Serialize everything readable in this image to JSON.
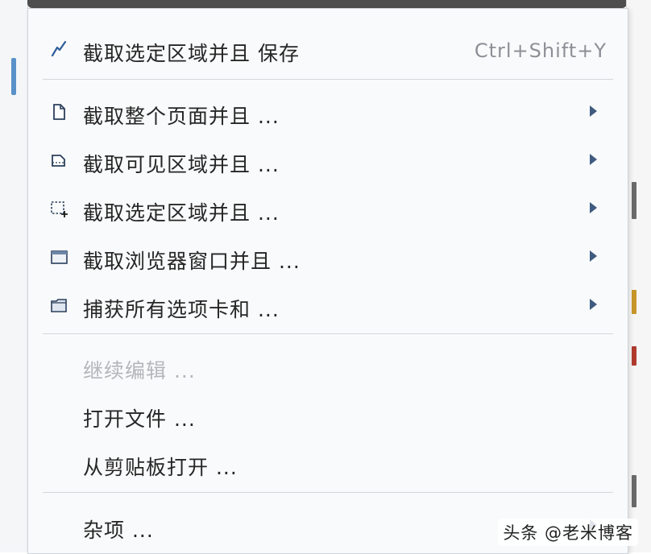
{
  "menu": {
    "items": [
      {
        "label": "截取选定区域并且 保存",
        "shortcut": "Ctrl+Shift+Y"
      },
      {
        "label": "截取整个页面并且 ..."
      },
      {
        "label": "截取可见区域并且 ..."
      },
      {
        "label": "截取选定区域并且 ..."
      },
      {
        "label": "截取浏览器窗口并且 ..."
      },
      {
        "label": "捕获所有选项卡和 ..."
      },
      {
        "label": "继续编辑 ..."
      },
      {
        "label": "打开文件 ..."
      },
      {
        "label": "从剪贴板打开 ..."
      },
      {
        "label": "杂项 ..."
      }
    ]
  },
  "watermark": "头条 @老米博客",
  "colors": {
    "accent": "#3d7fc1",
    "disabled_text": "#b3b6ba",
    "text": "#262626"
  }
}
